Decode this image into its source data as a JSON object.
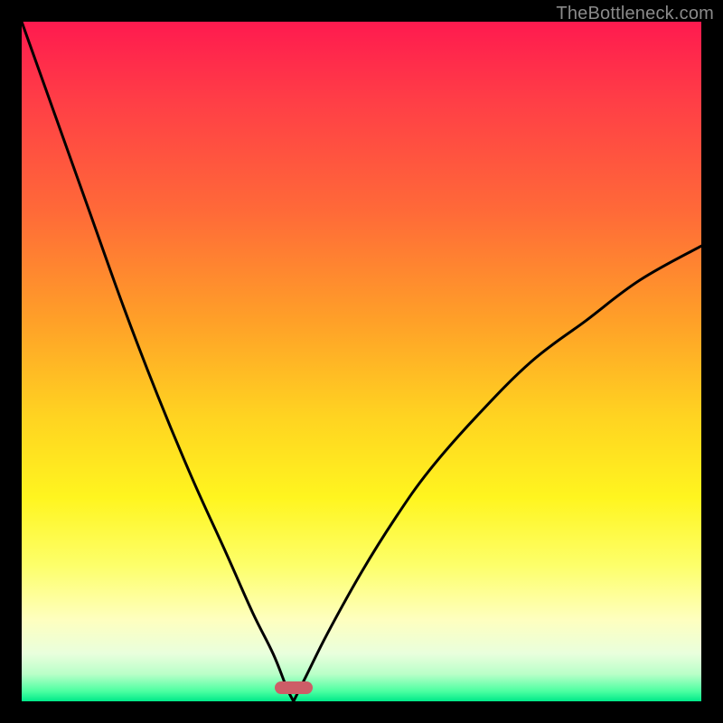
{
  "watermark": "TheBottleneck.com",
  "chart_data": {
    "type": "line",
    "title": "",
    "xlabel": "",
    "ylabel": "",
    "xlim": [
      0,
      100
    ],
    "ylim": [
      0,
      100
    ],
    "optimum_x": 40,
    "series": [
      {
        "name": "left-curve",
        "x": [
          0,
          5,
          10,
          15,
          20,
          25,
          30,
          34,
          37,
          39,
          40
        ],
        "y": [
          100,
          86,
          72,
          58,
          45,
          33,
          22,
          13,
          7,
          2,
          0
        ]
      },
      {
        "name": "right-curve",
        "x": [
          40,
          42,
          45,
          50,
          55,
          60,
          67,
          75,
          83,
          91,
          100
        ],
        "y": [
          0,
          4,
          10,
          19,
          27,
          34,
          42,
          50,
          56,
          62,
          67
        ]
      }
    ],
    "marker": {
      "x": 40,
      "y": 2,
      "color": "#cd5d67"
    },
    "gradient_colors": {
      "top": "#ff1a4f",
      "mid": "#ffe421",
      "bottom": "#00e989"
    }
  }
}
